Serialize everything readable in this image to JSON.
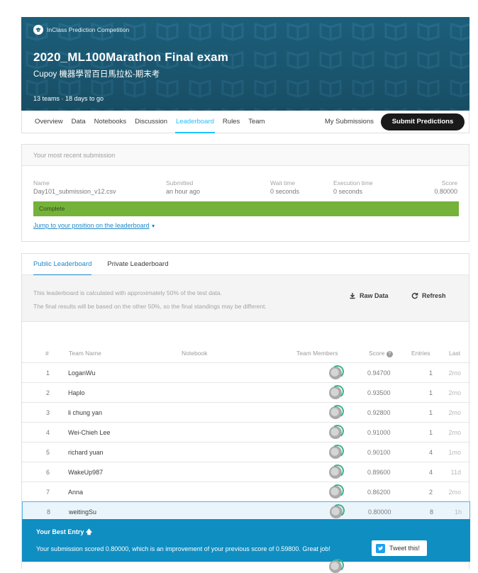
{
  "header": {
    "badge": "InClass Prediction Competition",
    "title": "2020_ML100Marathon Final exam",
    "subtitle": "Cupoy 機器學習百日馬拉松-期末考",
    "meta": "13 teams · 18 days to go"
  },
  "nav": {
    "tabs": [
      {
        "label": "Overview"
      },
      {
        "label": "Data"
      },
      {
        "label": "Notebooks"
      },
      {
        "label": "Discussion"
      },
      {
        "label": "Leaderboard",
        "active": true
      },
      {
        "label": "Rules"
      },
      {
        "label": "Team"
      }
    ],
    "my_submissions": "My Submissions",
    "submit": "Submit Predictions"
  },
  "recent": {
    "heading": "Your most recent submission",
    "name_label": "Name",
    "name_value": "Day101_submission_v12.csv",
    "submitted_label": "Submitted",
    "submitted_value": "an hour ago",
    "wait_label": "Wait time",
    "wait_value": "0 seconds",
    "exec_label": "Execution time",
    "exec_value": "0 seconds",
    "score_label": "Score",
    "score_value": "0.80000",
    "status": "Complete",
    "jump_link": "Jump to your position on the leaderboard"
  },
  "leaderboard": {
    "tabs": [
      "Public Leaderboard",
      "Private Leaderboard"
    ],
    "info_line1": "This leaderboard is calculated with approximately 50% of the test data.",
    "info_line2": "The final results will be based on the other 50%, so the final standings may be different.",
    "raw_data": "Raw Data",
    "refresh": "Refresh",
    "columns": {
      "rank": "#",
      "team": "Team Name",
      "notebook": "Notebook",
      "members": "Team Members",
      "score": "Score",
      "entries": "Entries",
      "last": "Last"
    },
    "rows": [
      {
        "rank": "1",
        "team": "LoganWu",
        "score": "0.94700",
        "entries": "1",
        "last": "2mo"
      },
      {
        "rank": "2",
        "team": "Haplo",
        "score": "0.93500",
        "entries": "1",
        "last": "2mo"
      },
      {
        "rank": "3",
        "team": "li chung yan",
        "score": "0.92800",
        "entries": "1",
        "last": "2mo"
      },
      {
        "rank": "4",
        "team": "Wei-Chieh Lee",
        "score": "0.91000",
        "entries": "1",
        "last": "2mo"
      },
      {
        "rank": "5",
        "team": "richard yuan",
        "score": "0.90100",
        "entries": "4",
        "last": "1mo"
      },
      {
        "rank": "6",
        "team": "WakeUp987",
        "score": "0.89600",
        "entries": "4",
        "last": "11d"
      },
      {
        "rank": "7",
        "team": "Anna",
        "score": "0.86200",
        "entries": "2",
        "last": "2mo"
      },
      {
        "rank": "8",
        "team": "weitingSu",
        "score": "0.80000",
        "entries": "8",
        "last": "1h"
      }
    ],
    "best_entry_title": "Your Best Entry",
    "best_entry_message": "Your submission scored 0.80000, which is an improvement of your previous score of 0.59800. Great job!",
    "tweet": "Tweet this!"
  },
  "colors": {
    "header_bg": "#1f5f7a",
    "accent": "#20beff",
    "complete": "#74b23a",
    "best_entry_bg": "#0f8ec2"
  }
}
